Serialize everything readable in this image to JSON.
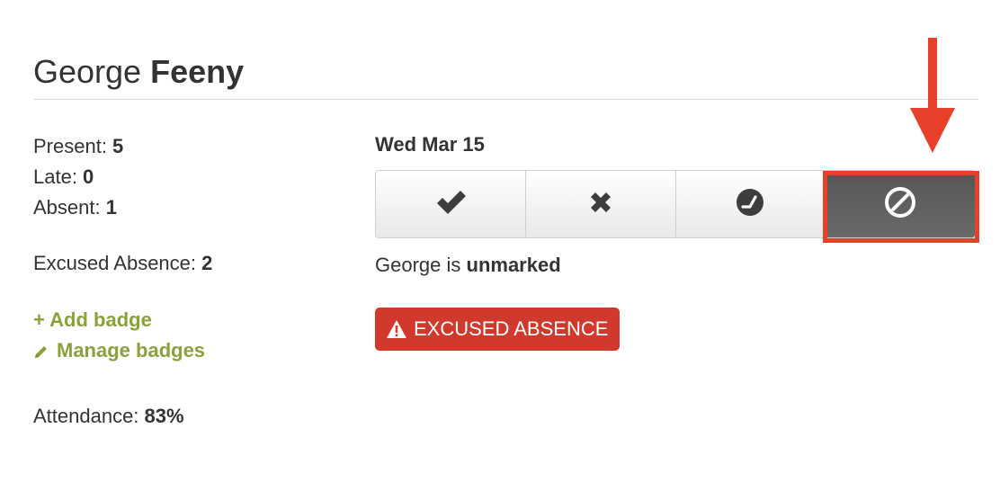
{
  "student": {
    "first_name": "George",
    "last_name": "Feeny"
  },
  "stats": {
    "present_label": "Present: ",
    "present_value": "5",
    "late_label": "Late: ",
    "late_value": "0",
    "absent_label": "Absent: ",
    "absent_value": "1",
    "excused_label": "Excused Absence: ",
    "excused_value": "2"
  },
  "badges": {
    "add_label": "+ Add badge",
    "manage_label": "Manage badges"
  },
  "attendance": {
    "label": "Attendance: ",
    "value": "83%"
  },
  "session": {
    "date": "Wed Mar 15",
    "status_prefix": "George is ",
    "status_value": "unmarked",
    "buttons": [
      {
        "icon": "checkmark-icon",
        "active": false
      },
      {
        "icon": "x-icon",
        "active": false
      },
      {
        "icon": "clock-icon",
        "active": false
      },
      {
        "icon": "prohibited-icon",
        "active": true
      }
    ],
    "excused_badge_label": "EXCUSED ABSENCE"
  },
  "colors": {
    "link_green": "#8aa23a",
    "badge_red": "#d0392b",
    "annotation_red": "#e8402b",
    "active_button": "#5e5e5e"
  }
}
